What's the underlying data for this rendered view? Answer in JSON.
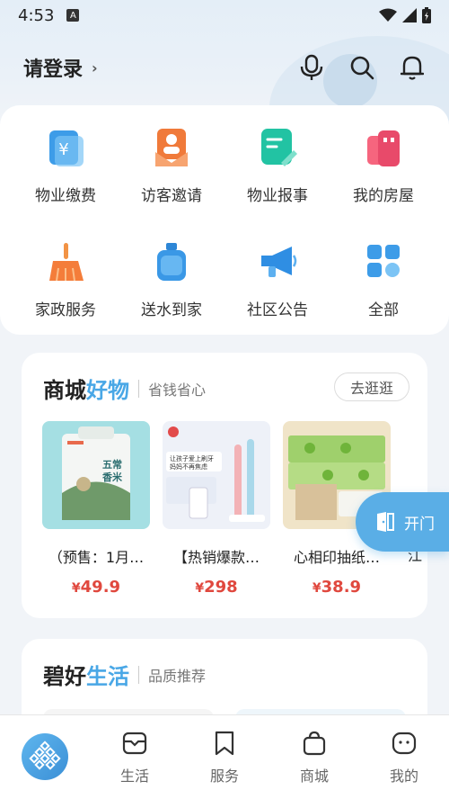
{
  "status_bar": {
    "time": "4:53",
    "notif_icon": "A"
  },
  "header": {
    "login_label": "请登录",
    "chevron": "›"
  },
  "services": [
    {
      "label": "物业缴费",
      "icon": "bill-icon"
    },
    {
      "label": "访客邀请",
      "icon": "visitor-icon"
    },
    {
      "label": "物业报事",
      "icon": "report-icon"
    },
    {
      "label": "我的房屋",
      "icon": "house-icon"
    },
    {
      "label": "家政服务",
      "icon": "broom-icon"
    },
    {
      "label": "送水到家",
      "icon": "water-icon"
    },
    {
      "label": "社区公告",
      "icon": "megaphone-icon"
    },
    {
      "label": "全部",
      "icon": "grid-icon"
    }
  ],
  "shop": {
    "title_main": "商城",
    "title_highlight": "好物",
    "subtitle": "省钱省心",
    "stroll_label": "去逛逛",
    "products": [
      {
        "name": "（预售：1月…",
        "currency": "¥",
        "price": "49.9",
        "image_text": "五常香米"
      },
      {
        "name": "【热销爆款…",
        "currency": "¥",
        "price": "298",
        "image_text": "让孩子爱上刷牙"
      },
      {
        "name": "心相印抽纸…",
        "currency": "¥",
        "price": "38.9",
        "image_text": ""
      }
    ],
    "peek_text": "江"
  },
  "open_door": {
    "label": "开门"
  },
  "life": {
    "title_main": "碧好",
    "title_highlight": "生活",
    "subtitle": "品质推荐"
  },
  "tabbar": {
    "items": [
      {
        "label": "",
        "icon": "home-logo-icon"
      },
      {
        "label": "生活",
        "icon": "life-icon"
      },
      {
        "label": "服务",
        "icon": "bookmark-icon"
      },
      {
        "label": "商城",
        "icon": "shopping-bag-icon"
      },
      {
        "label": "我的",
        "icon": "profile-icon"
      }
    ]
  },
  "colors": {
    "accent": "#49a7e6",
    "price": "#e0483e",
    "open_button": "#5aaee6"
  }
}
